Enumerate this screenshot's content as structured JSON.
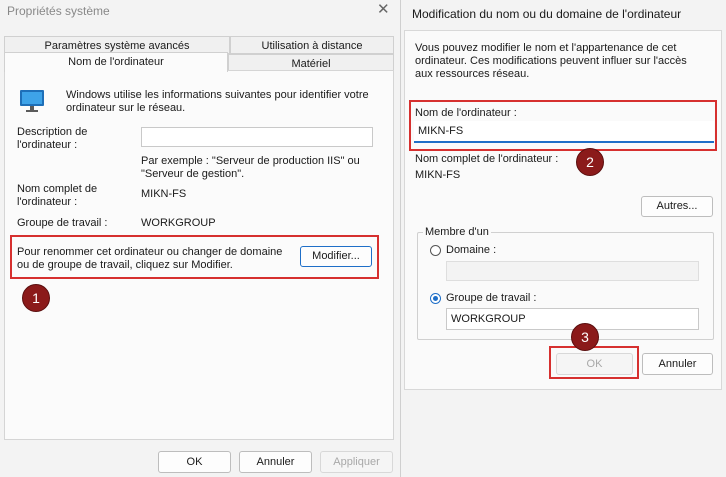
{
  "left_window": {
    "title": "Propriétés système",
    "tabs_row1": [
      "Paramètres système avancés",
      "Utilisation à distance"
    ],
    "tabs_row2": [
      "Nom de l'ordinateur",
      "Matériel"
    ],
    "intro": "Windows utilise les informations suivantes pour identifier votre ordinateur sur le réseau.",
    "description_label": "Description de l'ordinateur :",
    "description_value": "",
    "example": "Par exemple : \"Serveur de production IIS\" ou \"Serveur de gestion\".",
    "full_name_label": "Nom complet de l'ordinateur :",
    "full_name_value": "MIKN-FS",
    "workgroup_label": "Groupe de travail :",
    "workgroup_value": "WORKGROUP",
    "rename_text": "Pour renommer cet ordinateur ou changer de domaine ou de groupe de travail, cliquez sur Modifier.",
    "modify_button": "Modifier...",
    "ok_button": "OK",
    "cancel_button": "Annuler",
    "apply_button": "Appliquer"
  },
  "right_dialog": {
    "title": "Modification du nom ou du domaine de l'ordinateur",
    "intro": "Vous pouvez modifier le nom et l'appartenance de cet ordinateur. Ces modifications peuvent influer sur l'accès aux ressources réseau.",
    "computer_name_label": "Nom de l'ordinateur :",
    "computer_name_value": "MIKN-FS",
    "full_name_label": "Nom complet de l'ordinateur :",
    "full_name_value": "MIKN-FS",
    "more_button": "Autres...",
    "member_of_label": "Membre d'un",
    "domain_label": "Domaine :",
    "domain_value": "",
    "workgroup_label": "Groupe de travail :",
    "workgroup_value": "WORKGROUP",
    "ok_button": "OK",
    "cancel_button": "Annuler"
  },
  "badges": [
    "1",
    "2",
    "3"
  ],
  "colors": {
    "highlight": "#d6302f",
    "badge": "#8b1a1a",
    "radio_selected": "#1f6fc8"
  },
  "icons": [
    "close-icon",
    "monitor-icon"
  ]
}
